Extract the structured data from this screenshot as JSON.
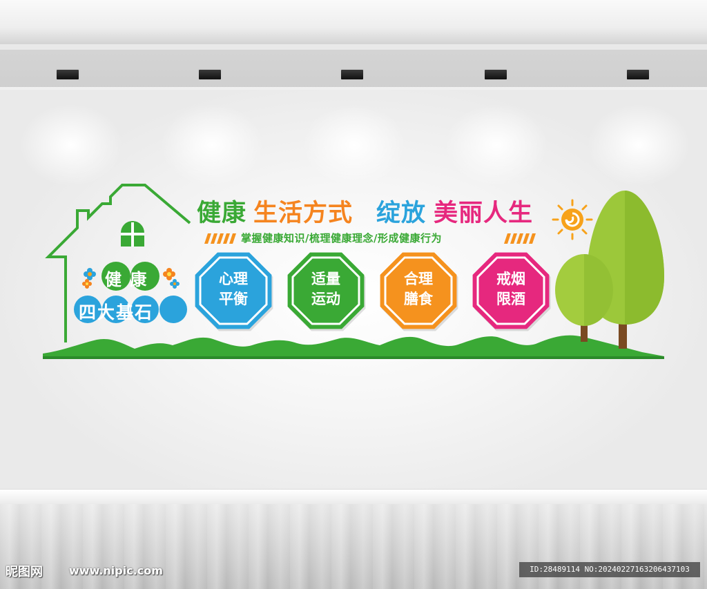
{
  "title": {
    "part1": "健康",
    "part2": "生活方式",
    "part3": "绽放",
    "part4": "美丽人生"
  },
  "subtitle": "掌握健康知识/梳理健康理念/形成健康行为",
  "badge": {
    "line1": "健 康",
    "line2": "四大基石"
  },
  "pillars": [
    {
      "line1": "心理",
      "line2": "平衡",
      "color": "#2ba3dc"
    },
    {
      "line1": "适量",
      "line2": "运动",
      "color": "#3aa935"
    },
    {
      "line1": "合理",
      "line2": "膳食",
      "color": "#f5921e"
    },
    {
      "line1": "戒烟",
      "line2": "限酒",
      "color": "#e6287e"
    }
  ],
  "colors": {
    "green": "#3aa935",
    "blue": "#2ba3dc",
    "orange": "#f5841f",
    "pink": "#e6287e",
    "tree_light": "#9cc83a",
    "trunk": "#7a4a22"
  },
  "icons": [
    "house-icon",
    "window-icon",
    "sun-icon",
    "tree-icon",
    "flower-icon"
  ],
  "watermark": {
    "logo": "昵图网",
    "url": "www.nipic.com",
    "id": "ID:28489114 NO:20240227163206437103"
  }
}
